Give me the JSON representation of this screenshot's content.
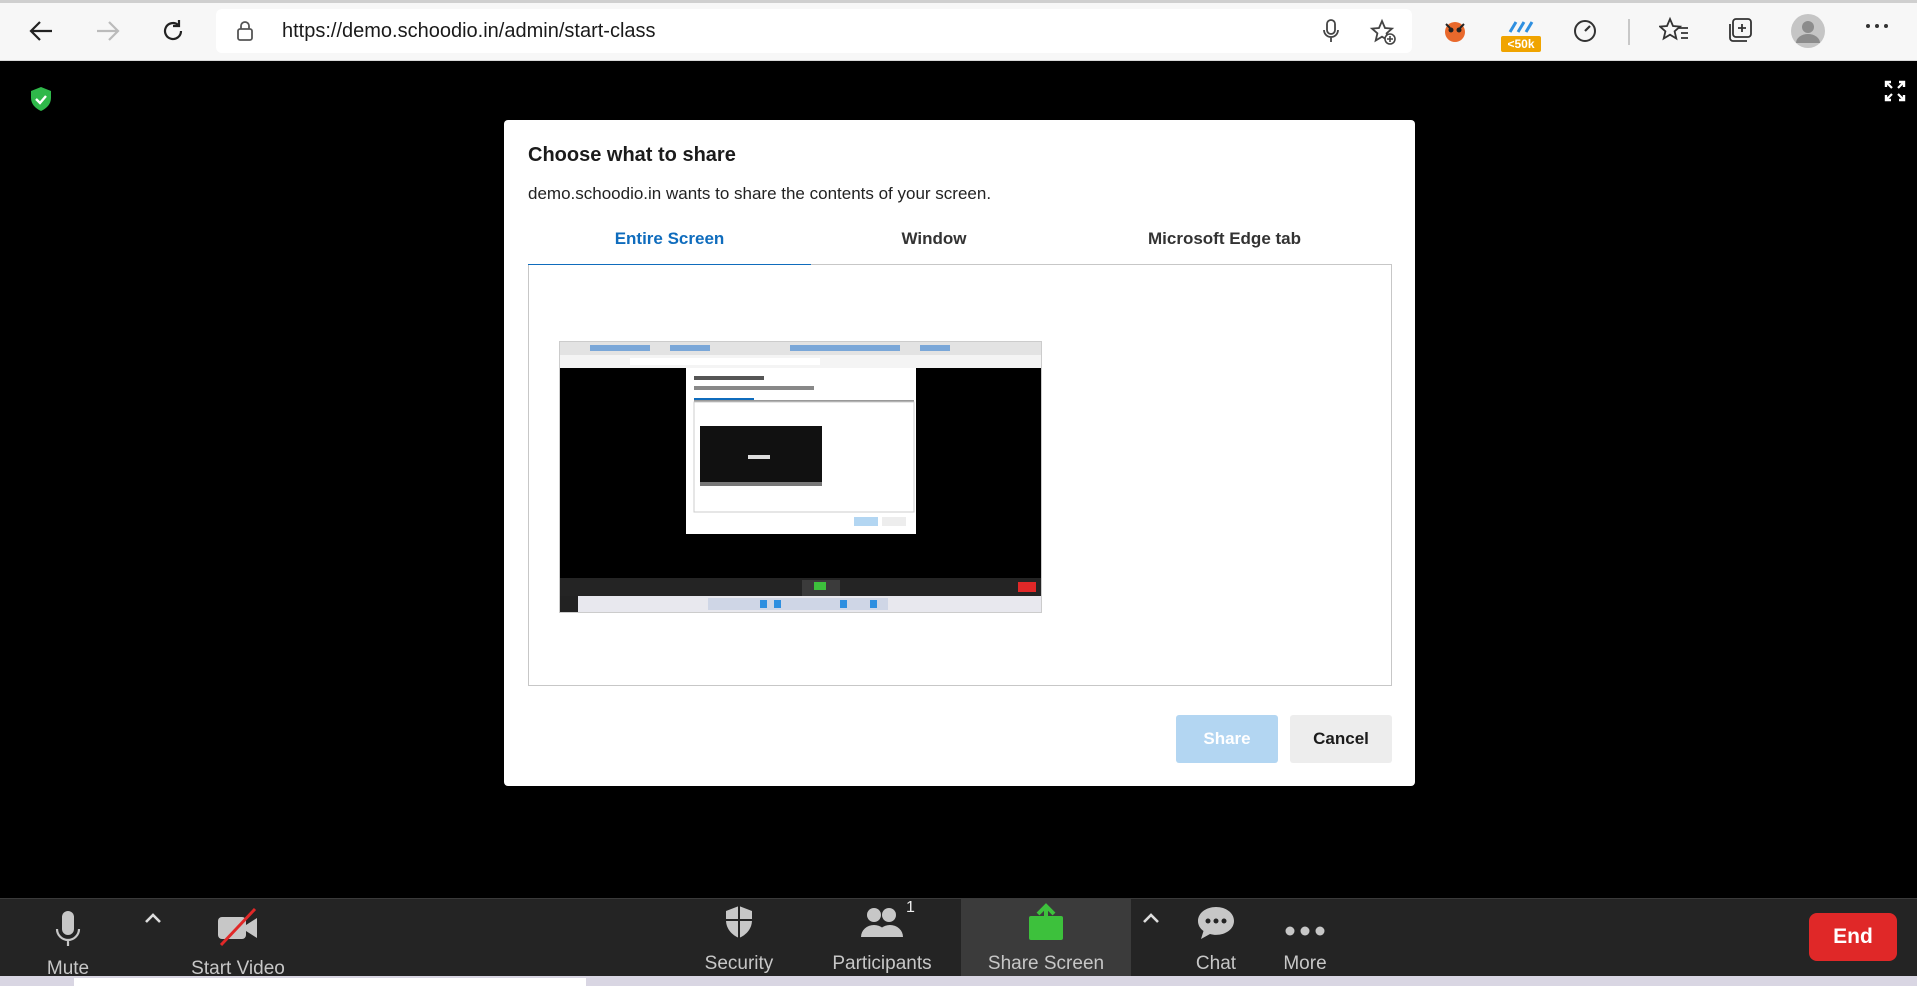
{
  "browser": {
    "url": "https://demo.schoodio.in/admin/start-class",
    "badge": "<50k",
    "icons": [
      "back-icon",
      "forward-icon",
      "refresh-icon",
      "lock-icon",
      "microphone-icon",
      "add-favorite-icon",
      "extension-icon",
      "extension-badge-icon",
      "performance-icon",
      "favorites-icon",
      "collections-icon",
      "profile-icon",
      "more-icon"
    ]
  },
  "dialog": {
    "title": "Choose what to share",
    "subtitle": "demo.schoodio.in wants to share the contents of your screen.",
    "tabs": [
      {
        "label": "Entire Screen",
        "active": true
      },
      {
        "label": "Window",
        "active": false
      },
      {
        "label": "Microsoft Edge tab",
        "active": false
      }
    ],
    "share_label": "Share",
    "cancel_label": "Cancel"
  },
  "toolbar": {
    "mute": "Mute",
    "start_video": "Start Video",
    "security": "Security",
    "participants": "Participants",
    "participants_count": "1",
    "share_screen": "Share Screen",
    "chat": "Chat",
    "more": "More",
    "end": "End"
  },
  "colors": {
    "accent": "#0f6cbd",
    "share_disabled": "#b3d6f2",
    "share_screen_green": "#3dc13c",
    "end_red": "#e02828",
    "shield_green": "#2fb84a"
  }
}
